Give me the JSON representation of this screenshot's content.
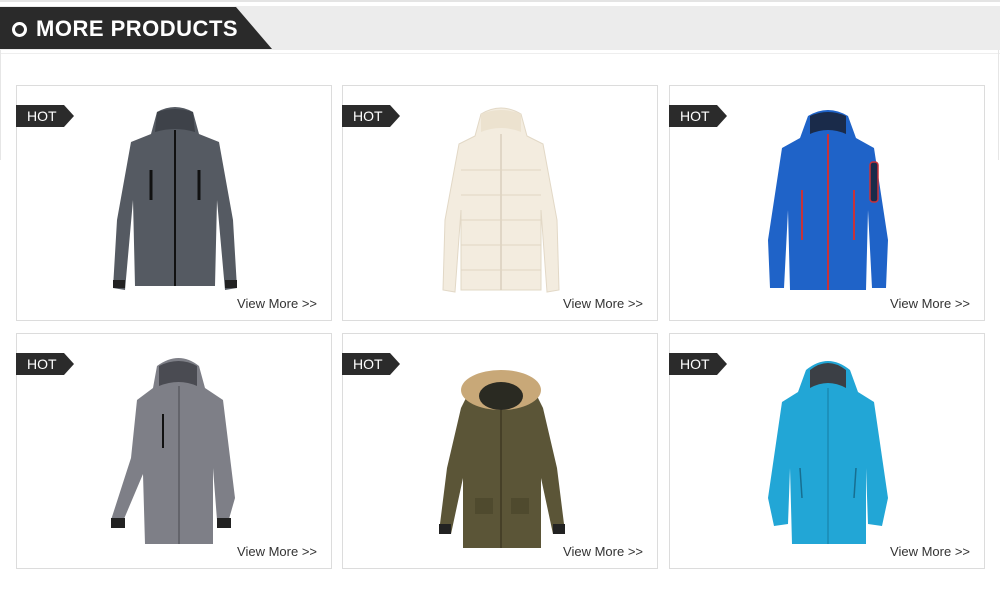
{
  "header": {
    "title": "MORE PRODUCTS",
    "icon": "circle-icon"
  },
  "products": [
    {
      "badge": "HOT",
      "link_label": "View More >>",
      "image": "dark-grey-softshell-jacket",
      "color": "#555a62"
    },
    {
      "badge": "HOT",
      "link_label": "View More >>",
      "image": "cream-puffer-jacket",
      "color": "#f3ecdf"
    },
    {
      "badge": "HOT",
      "link_label": "View More >>",
      "image": "blue-softshell-jacket",
      "color": "#1f63c8"
    },
    {
      "badge": "HOT",
      "link_label": "View More >>",
      "image": "grey-hooded-jacket",
      "color": "#7e7f87"
    },
    {
      "badge": "HOT",
      "link_label": "View More >>",
      "image": "olive-parka-fur-hood",
      "color": "#5b5537"
    },
    {
      "badge": "HOT",
      "link_label": "View More >>",
      "image": "turquoise-rain-jacket",
      "color": "#22a6d6"
    }
  ]
}
